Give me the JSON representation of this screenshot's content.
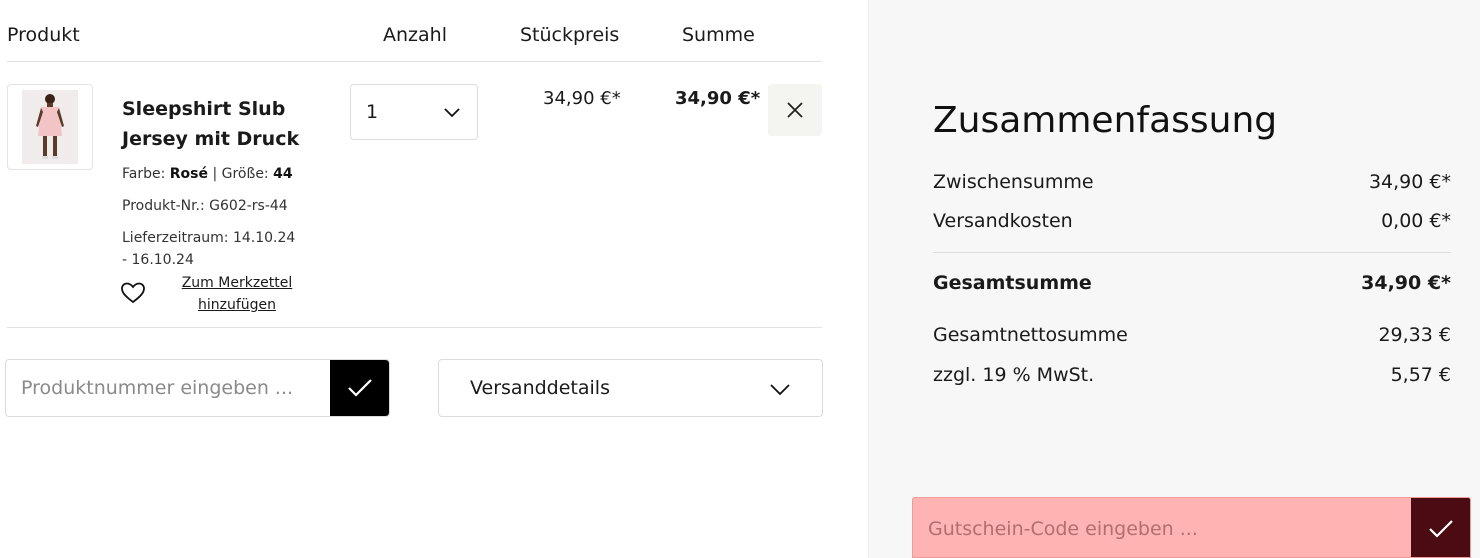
{
  "table": {
    "headers": {
      "produkt": "Produkt",
      "anzahl": "Anzahl",
      "stueckpreis": "Stückpreis",
      "summe": "Summe"
    }
  },
  "item": {
    "name": "Sleepshirt Slub Jersey mit Druck",
    "farbe_label": "Farbe:",
    "farbe_value": "Rosé",
    "groesse_label": "| Größe:",
    "groesse_value": "44",
    "produkt_nr": "Produkt-Nr.: G602-rs-44",
    "lieferzeitraum": "Lieferzeitraum: 14.10.24 - 16.10.24",
    "wishlist_link": "Zum Merkzettel hinzufügen",
    "quantity": "1",
    "unit_price": "34,90 €*",
    "total_price": "34,90 €*",
    "icons": {
      "wishlist": "heart-icon",
      "remove": "close-icon",
      "quantity": "chevron-down-icon"
    }
  },
  "product_number": {
    "placeholder": "Produktnummer eingeben ...",
    "submit_icon": "checkmark-icon"
  },
  "shipping": {
    "label": "Versanddetails",
    "icon": "chevron-down-icon"
  },
  "summary": {
    "title": "Zusammenfassung",
    "rows": [
      {
        "label": "Zwischensumme",
        "value": "34,90 €*"
      },
      {
        "label": "Versandkosten",
        "value": "0,00 €*"
      },
      {
        "label": "Gesamtsumme",
        "value": "34,90 €*"
      },
      {
        "label": "Gesamtnettosumme",
        "value": "29,33 €"
      },
      {
        "label": "zzgl. 19 % MwSt.",
        "value": "5,57 €"
      }
    ]
  },
  "coupon": {
    "placeholder": "Gutschein-Code eingeben ...",
    "submit_icon": "checkmark-icon"
  },
  "colors": {
    "coupon_bg": "#ffb3b3",
    "coupon_button": "#4a0c12",
    "submit_button": "#000000",
    "summary_bg": "#f7f7f7"
  }
}
